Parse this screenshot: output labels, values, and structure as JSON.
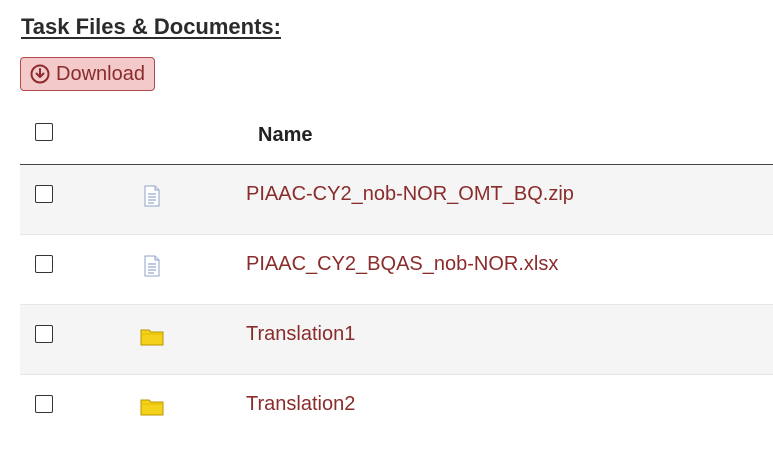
{
  "section": {
    "title": "Task Files & Documents:"
  },
  "toolbar": {
    "download_label": "Download",
    "download_icon": "download-circle-icon"
  },
  "table": {
    "columns": [
      "Name"
    ],
    "rows": [
      {
        "name": "PIAAC-CY2_nob-NOR_OMT_BQ.zip",
        "type": "file",
        "icon": "file-icon"
      },
      {
        "name": "PIAAC_CY2_BQAS_nob-NOR.xlsx",
        "type": "file",
        "icon": "file-icon"
      },
      {
        "name": "Translation1",
        "type": "folder",
        "icon": "folder-icon"
      },
      {
        "name": "Translation2",
        "type": "folder",
        "icon": "folder-icon"
      }
    ]
  },
  "colors": {
    "accent": "#8a2c2c",
    "button_bg": "#f3c9c9",
    "row_shade": "#f5f5f5",
    "folder": "#f5d21a"
  }
}
